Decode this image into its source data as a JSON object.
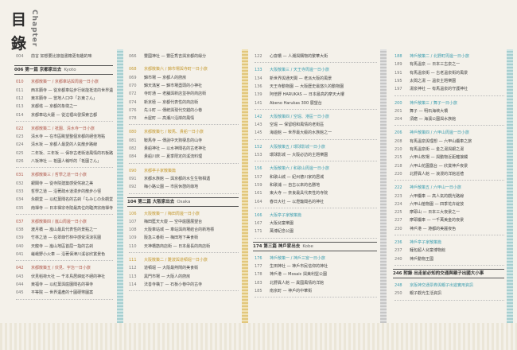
{
  "title": {
    "kanji_1": "目",
    "kanji_2": "錄",
    "chapter": "Chapter"
  },
  "col1": {
    "top": [
      {
        "pg": "004",
        "tx": "前言 如想要比旅遊書籍更有趣的味"
      }
    ],
    "band": {
      "tx": "006 第一篇 京都家出去",
      "en": "Kyoto"
    },
    "groups": [
      {
        "head": {
          "pg": "010",
          "tx": "京都散策一 / 京都車站與周邊一日小旅"
        },
        "rows": [
          {
            "pg": "011",
            "tx": "西本願寺 — 從京都車站步行就能抵達的世界遺產"
          },
          {
            "pg": "012",
            "tx": "東本願寺 — 當地人口中「お東さん」"
          },
          {
            "pg": "013",
            "tx": "京都塔 — 京都的象徵之一"
          },
          {
            "pg": "014",
            "tx": "京都車站大廳 — 從這裡出發探索古都"
          }
        ]
      },
      {
        "head": {
          "pg": "022",
          "tx": "京都散策二 / 祇園、清水寺一日小旅"
        },
        "rows": [
          {
            "pg": "023",
            "tx": "清水寺 — 在市區眺望整個京都的絕佳地點"
          },
          {
            "pg": "024",
            "tx": "清水坂 — 京都人最愛的人氣散步路線"
          },
          {
            "pg": "025",
            "tx": "二年坂、三年坂 — 保存古老街道風情的石板路"
          },
          {
            "pg": "026",
            "tx": "八坂神社 — 祇園人稱呼的「祇園さん」"
          }
        ]
      },
      {
        "head": {
          "pg": "031",
          "tx": "京都散策三 / 哲學之道一日小旅"
        },
        "rows": [
          {
            "pg": "032",
            "tx": "銀閣寺 — 從寺院建築感受侘寂之美"
          },
          {
            "pg": "033",
            "tx": "哲學之道 — 沿著疏水道漫步的散步小徑"
          },
          {
            "pg": "034",
            "tx": "永觀堂 — 以紅葉聞名的古剎「もみじの永觀堂」"
          },
          {
            "pg": "035",
            "tx": "南禪寺 — 日本禪宗寺院最高位的臨濟宗南禪寺"
          }
        ]
      },
      {
        "head": {
          "pg": "037",
          "tx": "京都散策四 / 嵐山周邊一日小旅"
        },
        "rows": [
          {
            "pg": "038",
            "tx": "渡月橋 — 嵐山最具代表性的景點之一"
          },
          {
            "pg": "039",
            "tx": "竹林之道 — 在翠綠竹林中感受清涼氛圍"
          },
          {
            "pg": "040",
            "tx": "天龍寺 — 嵐山地區首屈一指的古剎"
          },
          {
            "pg": "041",
            "tx": "嵯峨野小火車 — 沿著保津川溪谷欣賞景色"
          }
        ]
      },
      {
        "head": {
          "pg": "042",
          "tx": "京都散策五 / 伏見、宇治一日小旅"
        },
        "rows": [
          {
            "pg": "043",
            "tx": "伏見稻荷大社 — 千本鳥居綿延不絕的神社"
          },
          {
            "pg": "044",
            "tx": "東福寺 — 以紅葉與庭園聞名的禪寺"
          },
          {
            "pg": "045",
            "tx": "平等院 — 世界遺產的十圓硬幣圖案"
          }
        ]
      }
    ]
  },
  "col2": {
    "top": [
      {
        "pg": "066",
        "tx": "豐國神社 — 豐臣秀吉與京都的緣分"
      }
    ],
    "groups": [
      {
        "head": {
          "pg": "068",
          "tx": "京都散策六 / 錦市場與寺町一日小旅"
        },
        "rows": [
          {
            "pg": "069",
            "tx": "錦市場 — 京都人的廚房"
          },
          {
            "pg": "070",
            "tx": "錦天滿宮 — 錦市場盡頭的小神社"
          },
          {
            "pg": "072",
            "tx": "寺町通 — 老舖與新店並存的商店街"
          },
          {
            "pg": "074",
            "tx": "新京極 — 京都代表性的商店街"
          },
          {
            "pg": "076",
            "tx": "先斗町 — 傳統與現代交錯的小巷"
          },
          {
            "pg": "078",
            "tx": "木屋町 — 高瀬川沿岸的風情"
          }
        ]
      },
      {
        "head": {
          "pg": "080",
          "tx": "京都散策七 / 鞍馬、貴船一日小旅"
        },
        "rows": [
          {
            "pg": "081",
            "tx": "鞍馬寺 — 傳說中天狗棲息的山寺"
          },
          {
            "pg": "082",
            "tx": "貴船神社 — 以水神聞名的古老神社"
          },
          {
            "pg": "084",
            "tx": "貴船川床 — 夏季限定的溪流料理"
          }
        ]
      },
      {
        "head": {
          "pg": "090",
          "tx": "京都亭子家散策篇"
        },
        "rows": [
          {
            "pg": "091",
            "tx": "京都水族館 — 與京都的水生生物相遇"
          },
          {
            "pg": "092",
            "tx": "梅小路公園 — 市民休憩的綠地"
          }
        ]
      }
    ],
    "band": {
      "tx": "104 第二篇 大阪家出去",
      "en": "Osaka"
    },
    "groups2": [
      {
        "head": {
          "pg": "106",
          "tx": "大阪散策一 / 梅田周邊一日小旅"
        },
        "rows": [
          {
            "pg": "107",
            "tx": "梅田藍天大廈 — 空中庭園展望台"
          },
          {
            "pg": "108",
            "tx": "大阪車站城 — 車站與商場結合的新地標"
          },
          {
            "pg": "109",
            "tx": "阪急三番街 — 梅田地下美食街"
          },
          {
            "pg": "110",
            "tx": "天神橋筋商店街 — 日本最長的商店街"
          }
        ]
      },
      {
        "head": {
          "pg": "111",
          "tx": "大阪散策二 / 難波與道頓堀一日小旅"
        },
        "rows": [
          {
            "pg": "112",
            "tx": "道頓堀 — 大阪最熱鬧的美食街"
          },
          {
            "pg": "113",
            "tx": "黑門市場 — 大阪人的廚房"
          },
          {
            "pg": "114",
            "tx": "法善寺橫丁 — 石板小巷中的古寺"
          }
        ]
      }
    ]
  },
  "col3": {
    "groups": [
      {
        "head": {
          "pg": "122",
          "tx": "心齋橋 — 人潮與購物的繁華大街"
        },
        "plain": true,
        "rows": []
      },
      {
        "head": {
          "pg": "133",
          "tx": "大阪散策三 / 天王寺周邊一日小旅"
        },
        "rows": [
          {
            "pg": "134",
            "tx": "新世界與通天閣 — 老派大阪的風景"
          },
          {
            "pg": "136",
            "tx": "天王寺動物園 — 大阪歷史最悠久的動物園"
          },
          {
            "pg": "139",
            "tx": "阿倍野 HARUKAS — 日本最高的摩天大樓"
          },
          {
            "pg": "141",
            "tx": "Abeno Harukas 300 展望台"
          }
        ]
      },
      {
        "head": {
          "pg": "142",
          "tx": "大阪散策四 / 空堀、港區一日小旅"
        },
        "rows": [
          {
            "pg": "143",
            "tx": "空堀 — 保留昭和風情的老街區"
          },
          {
            "pg": "145",
            "tx": "海遊館 — 世界最大級的水族館之一"
          }
        ]
      },
      {
        "head": {
          "pg": "152",
          "tx": "大阪散策五 / 環球影城一日小旅"
        },
        "rows": [
          {
            "pg": "153",
            "tx": "環球影城 — 大阪必訪的主題樂園"
          }
        ]
      },
      {
        "head": {
          "pg": "156",
          "tx": "大阪散策六 / 和歌山周邊一日小旅"
        },
        "rows": [
          {
            "pg": "157",
            "tx": "和歌山城 — 紀州德川家的居城"
          },
          {
            "pg": "159",
            "tx": "和歌浦 — 自古以來的名勝地"
          },
          {
            "pg": "161",
            "tx": "東大寺 — 奈良最具代表性的寺院"
          },
          {
            "pg": "164",
            "tx": "春日大社 — 以燈籠聞名的神社"
          }
        ]
      },
      {
        "head": {
          "pg": "166",
          "tx": "大阪亭子家散策篇"
        },
        "rows": [
          {
            "pg": "167",
            "tx": "大阪兒童樂園"
          },
          {
            "pg": "171",
            "tx": "萬博紀念公園"
          }
        ]
      }
    ],
    "band": {
      "tx": "174 第三篇 神戶家出去",
      "en": "Kobe"
    },
    "groups2": [
      {
        "head": {
          "pg": "176",
          "tx": "神戶散策一 / 神戶三宮一日小旅"
        },
        "rows": [
          {
            "pg": "177",
            "tx": "生田神社 — 神戶市民信仰的神社"
          },
          {
            "pg": "178",
            "tx": "神戶港 — Mosaic 與美利堅公園"
          },
          {
            "pg": "183",
            "tx": "北野異人館 — 異國風情的洋館"
          },
          {
            "pg": "185",
            "tx": "南京町 — 神戶的中華街"
          }
        ]
      }
    ]
  },
  "col4": {
    "groups": [
      {
        "head": {
          "pg": "188",
          "tx": "神戶散策二 / 北野町周邊一日小旅"
        },
        "rows": [
          {
            "pg": "189",
            "tx": "有馬溫泉 — 日本三古泉之一"
          },
          {
            "pg": "191",
            "tx": "有馬溫泉街 — 古老溫泉街的風景"
          },
          {
            "pg": "195",
            "tx": "太閤之湯 — 溫泉主題樂園"
          },
          {
            "pg": "197",
            "tx": "湯泉神社 — 有馬溫泉的守護神社"
          }
        ]
      },
      {
        "head": {
          "pg": "200",
          "tx": "神戶散策三 / 舞子一日小旅"
        },
        "rows": [
          {
            "pg": "201",
            "tx": "舞子 — 明石海峽大橋"
          },
          {
            "pg": "204",
            "tx": "須磨 — 海濱公園與水族館"
          }
        ]
      },
      {
        "head": {
          "pg": "206",
          "tx": "神戶散策四 / 六甲山周邊一日小旅"
        },
        "rows": [
          {
            "pg": "208",
            "tx": "有馬溫泉與理想 — 六甲山纜車之旅"
          },
          {
            "pg": "210",
            "tx": "有馬溫泉街 — 金之湯與銀之湯"
          },
          {
            "pg": "215",
            "tx": "六甲山牧場 — 與動物近距離接觸"
          },
          {
            "pg": "218",
            "tx": "六甲山花園露台 — 欣賞神戶夜景"
          },
          {
            "pg": "220",
            "tx": "北野異人館 — 浪漫的洋館巡禮"
          }
        ]
      },
      {
        "head": {
          "pg": "222",
          "tx": "神戶散策五 / 六甲山一日小旅"
        },
        "rows": [
          {
            "pg": "223",
            "tx": "六甲纜車 — 高人氣的觀光路線"
          },
          {
            "pg": "224",
            "tx": "六甲山植物園 — 四季花卉綻放"
          },
          {
            "pg": "225",
            "tx": "摩耶山 — 日本三大夜景之一"
          },
          {
            "pg": "227",
            "tx": "摩耶纜車 — 一千萬美金的夜景"
          },
          {
            "pg": "230",
            "tx": "神戶港 — 港都的美麗夜色"
          }
        ]
      },
      {
        "head": {
          "pg": "236",
          "tx": "神戶亭子家散策篇"
        },
        "rows": [
          {
            "pg": "237",
            "tx": "麵包超人兒童博物館"
          },
          {
            "pg": "240",
            "tx": "神戶動物王國"
          }
        ]
      }
    ],
    "band": {
      "tx": "246 附錄 出走前必知的交通與親子出國大小事",
      "en": ""
    },
    "groups2": [
      {
        "head": {
          "pg": "248",
          "tx": "京阪神交通票券與親子出遊實用資訊"
        },
        "rows": [
          {
            "pg": "250",
            "tx": "親子觀光生活資訊"
          }
        ]
      }
    ]
  }
}
